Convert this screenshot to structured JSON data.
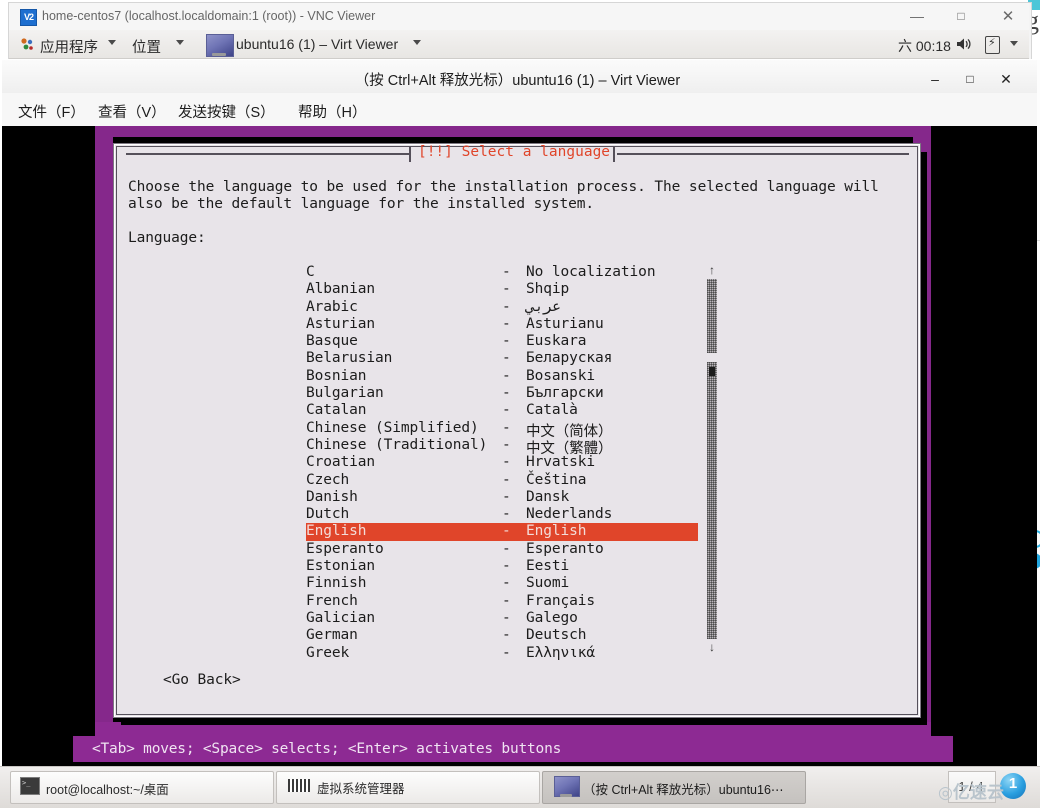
{
  "vnc_window": {
    "title": "home-centos7 (localhost.localdomain:1 (root)) - VNC Viewer",
    "icon": "V2",
    "minimize": "—",
    "maximize": "□",
    "close": "✕"
  },
  "gnome_panel": {
    "applications": "应用程序",
    "places": "位置",
    "task_button": "ubuntu16 (1) – Virt Viewer",
    "clock": "六 00:18",
    "volume_icon": "🔊",
    "battery_bolt": "⚡"
  },
  "virt_viewer": {
    "title": "（按 Ctrl+Alt 释放光标）ubuntu16 (1) – Virt Viewer",
    "minimize": "–",
    "maximize": "□",
    "close": "✕",
    "menu": [
      {
        "label": "文件（F）"
      },
      {
        "label": "查看（V）"
      },
      {
        "label": "发送按键（S）"
      },
      {
        "label": "帮助（H）"
      }
    ]
  },
  "installer": {
    "dialog_title": "[!!] Select a language",
    "description_line1": "Choose the language to be used for the installation process. The selected language will",
    "description_line2": "also be the default language for the installed system.",
    "list_label": "Language:",
    "go_back": "<Go Back>",
    "status_line": "<Tab> moves; <Space> selects; <Enter> activates buttons",
    "scroll_up_arrow": "↑",
    "scroll_down_arrow": "↓",
    "separator": "-",
    "selected_language": "English",
    "languages": [
      {
        "name": "C",
        "native": "No localization",
        "selected": false
      },
      {
        "name": "Albanian",
        "native": "Shqip",
        "selected": false
      },
      {
        "name": "Arabic",
        "native": "عربي",
        "selected": false
      },
      {
        "name": "Asturian",
        "native": "Asturianu",
        "selected": false
      },
      {
        "name": "Basque",
        "native": "Euskara",
        "selected": false
      },
      {
        "name": "Belarusian",
        "native": "Беларуская",
        "selected": false
      },
      {
        "name": "Bosnian",
        "native": "Bosanski",
        "selected": false
      },
      {
        "name": "Bulgarian",
        "native": "Български",
        "selected": false
      },
      {
        "name": "Catalan",
        "native": "Català",
        "selected": false
      },
      {
        "name": "Chinese (Simplified)",
        "native": "中文（简体）",
        "selected": false
      },
      {
        "name": "Chinese (Traditional)",
        "native": "中文（繁體）",
        "selected": false
      },
      {
        "name": "Croatian",
        "native": "Hrvatski",
        "selected": false
      },
      {
        "name": "Czech",
        "native": "Čeština",
        "selected": false
      },
      {
        "name": "Danish",
        "native": "Dansk",
        "selected": false
      },
      {
        "name": "Dutch",
        "native": "Nederlands",
        "selected": false
      },
      {
        "name": "English",
        "native": "English",
        "selected": true
      },
      {
        "name": "Esperanto",
        "native": "Esperanto",
        "selected": false
      },
      {
        "name": "Estonian",
        "native": "Eesti",
        "selected": false
      },
      {
        "name": "Finnish",
        "native": "Suomi",
        "selected": false
      },
      {
        "name": "French",
        "native": "Français",
        "selected": false
      },
      {
        "name": "Galician",
        "native": "Galego",
        "selected": false
      },
      {
        "name": "German",
        "native": "Deutsch",
        "selected": false
      },
      {
        "name": "Greek",
        "native": "Ελληνικά",
        "selected": false
      }
    ]
  },
  "taskbar": {
    "items": [
      {
        "label": "root@localhost:~/桌面",
        "active": false
      },
      {
        "label": "虚拟系统管理器",
        "active": false
      },
      {
        "label": "（按 Ctrl+Alt 释放光标）ubuntu16⋯",
        "active": true
      }
    ],
    "workspace": "1 / 4",
    "notification_badge": "1",
    "watermark": "◎亿速云"
  },
  "background_page": {
    "big_glyph": "g",
    "link_text": "r"
  },
  "colors": {
    "installer_purple": "#85288b",
    "highlight_red": "#e0452a",
    "dialog_bg": "#e8e4e9",
    "console_black": "#000000"
  }
}
